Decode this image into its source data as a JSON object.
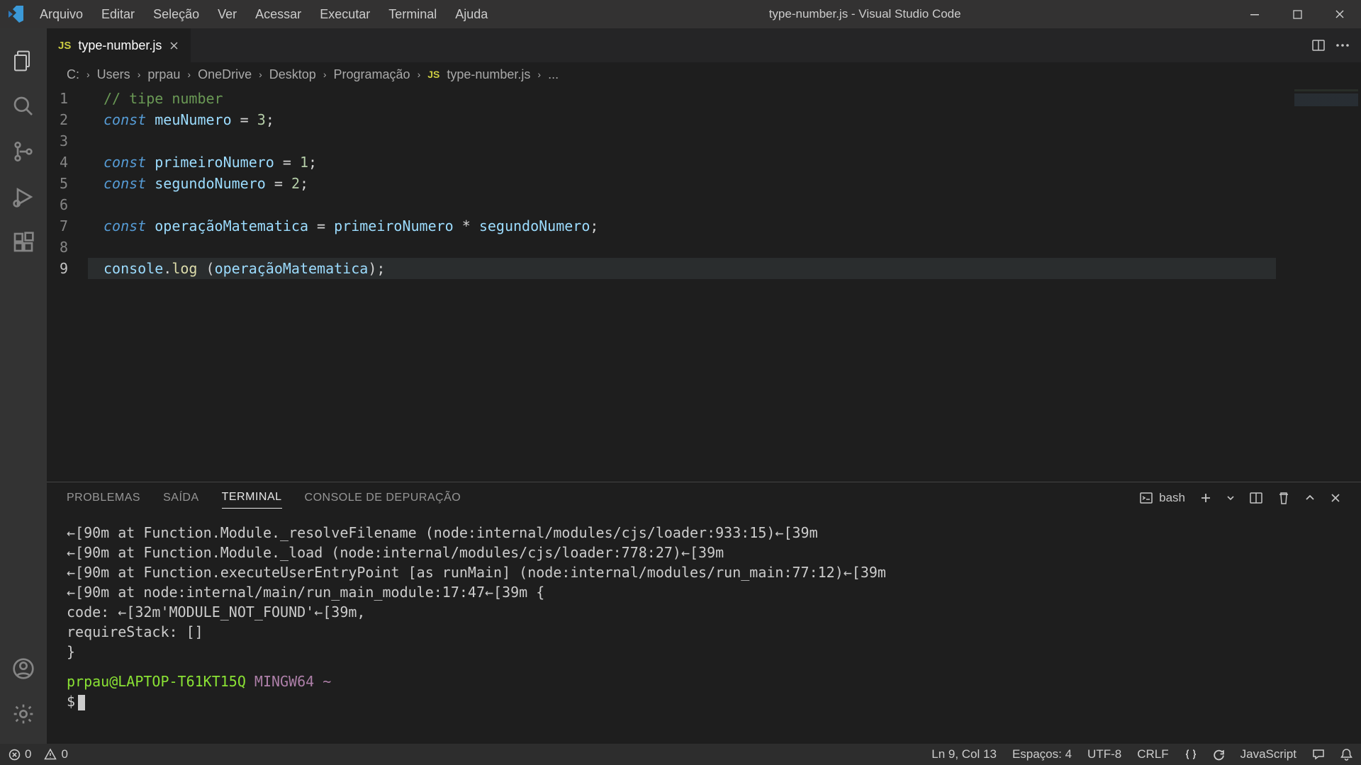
{
  "window_title": "type-number.js - Visual Studio Code",
  "menus": [
    "Arquivo",
    "Editar",
    "Seleção",
    "Ver",
    "Acessar",
    "Executar",
    "Terminal",
    "Ajuda"
  ],
  "tab": {
    "label": "type-number.js"
  },
  "breadcrumb": [
    "C:",
    "Users",
    "prpau",
    "OneDrive",
    "Desktop",
    "Programação",
    "type-number.js",
    "..."
  ],
  "code_lines": {
    "l1_comment": "// tipe number",
    "l2_kw": "const",
    "l2_var": "meuNumero",
    "l2_eq": " = ",
    "l2_num": "3",
    "l2_sc": ";",
    "l4_kw": "const",
    "l4_var": "primeiroNumero",
    "l4_eq": " = ",
    "l4_num": "1",
    "l4_sc": ";",
    "l5_kw": "const",
    "l5_var": "segundoNumero",
    "l5_eq": " = ",
    "l5_num": "2",
    "l5_sc": ";",
    "l7_kw": "const",
    "l7_var": "operaçãoMatematica",
    "l7_eq": " = ",
    "l7_a": "primeiroNumero",
    "l7_op": " * ",
    "l7_b": "segundoNumero",
    "l7_sc": ";",
    "l9_console": "console",
    "l9_dot": ".",
    "l9_log": "log",
    "l9_sp": " (",
    "l9_arg": "operaçãoMatematica",
    "l9_end": ");"
  },
  "line_numbers": [
    "1",
    "2",
    "3",
    "4",
    "5",
    "6",
    "7",
    "8",
    "9"
  ],
  "panel_tabs": {
    "problemas": "PROBLEMAS",
    "saida": "SAÍDA",
    "terminal": "TERMINAL",
    "debug": "CONSOLE DE DEPURAÇÃO"
  },
  "shell_name": "bash",
  "terminal_lines": [
    "←[90m    at Function.Module._resolveFilename (node:internal/modules/cjs/loader:933:15)←[39m",
    "←[90m    at Function.Module._load (node:internal/modules/cjs/loader:778:27)←[39m",
    "←[90m    at Function.executeUserEntryPoint [as runMain] (node:internal/modules/run_main:77:12)←[39m",
    "←[90m    at node:internal/main/run_main_module:17:47←[39m {",
    "  code: ←[32m'MODULE_NOT_FOUND'←[39m,",
    "  requireStack: []",
    "}"
  ],
  "prompt": {
    "user_host": "prpau@LAPTOP-T61KT15Q",
    "shell": "MINGW64",
    "path": "~",
    "symbol": "$"
  },
  "status": {
    "errors": "0",
    "warnings": "0",
    "ln_col": "Ln 9, Col 13",
    "spaces": "Espaços: 4",
    "encoding": "UTF-8",
    "eol": "CRLF",
    "lang": "JavaScript"
  }
}
